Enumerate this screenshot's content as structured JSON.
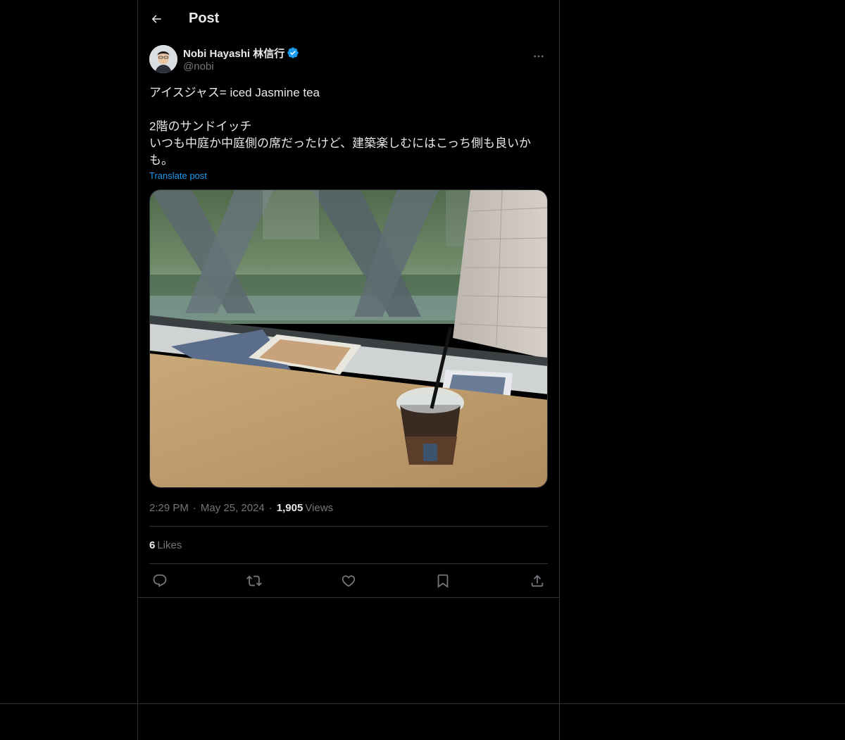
{
  "header": {
    "back_icon": "arrow-left-icon",
    "title": "Post"
  },
  "post": {
    "author": {
      "display_name": "Nobi Hayashi 林信行",
      "handle": "@nobi",
      "verified": true,
      "verified_color": "#1d9bf0"
    },
    "more_icon": "more-horizontal-icon",
    "text": "アイスジャス= iced Jasmine tea\n\n2階のサンドイッチ\nいつも中庭か中庭側の席だったけど、建築楽しむにはこっち側も良いかも。",
    "translate_label": "Translate post",
    "time": "2:29 PM",
    "date": "May 25, 2024",
    "separator": "·",
    "views_count": "1,905",
    "views_label": "Views",
    "likes_count": "6",
    "likes_label": "Likes",
    "actions": {
      "reply_icon": "reply-icon",
      "repost_icon": "repost-icon",
      "like_icon": "heart-icon",
      "bookmark_icon": "bookmark-icon",
      "share_icon": "share-icon"
    }
  },
  "colors": {
    "background": "#000000",
    "text": "#e7e9ea",
    "muted": "#71767b",
    "border": "#2f3336",
    "link": "#1d9bf0"
  }
}
